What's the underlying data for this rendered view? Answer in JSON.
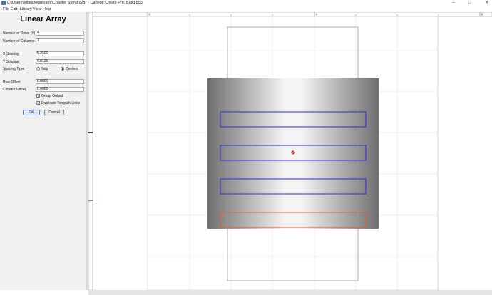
{
  "window": {
    "title": "C:\\Users\\willa\\Downloads\\Coaster Stand.c2d* - Carbide Create Pro, Build 853",
    "controls": [
      "–",
      "□",
      "✕"
    ]
  },
  "menu": [
    "File",
    "Edit",
    "Library",
    "View",
    "Help"
  ],
  "panel": {
    "heading": "Linear Array",
    "rows_label": "Number of Rows (Y)",
    "rows_value": "4",
    "cols_label": "Number of Columns (X)",
    "cols_value": "1",
    "xspacing_label": "X Spacing",
    "xspacing_value": "5.2500",
    "yspacing_label": "Y Spacing",
    "yspacing_value": "0.8125",
    "spacing_type_label": "Spacing Type",
    "gap_label": "Gap",
    "centers_label": "Centers",
    "row_offset_label": "Row Offset",
    "row_offset_value": "0.0000",
    "col_offset_label": "Column Offset",
    "col_offset_value": "0.0000",
    "group_output_label": "Group Output",
    "dup_toolpath_label": "Duplicate Toolpath Links",
    "ok_label": "OK",
    "cancel_label": "Cancel"
  },
  "ruler": {
    "tick_labels": [
      "0",
      "4",
      "8"
    ]
  },
  "colors": {
    "selected_rect": "#2b2bd6",
    "preview_rect": "#e0622a",
    "origin_marker": "#d02020"
  }
}
